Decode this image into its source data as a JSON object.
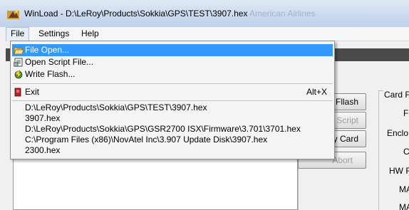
{
  "window": {
    "title": "WinLoad - D:\\LeRoy\\Products\\Sokkia\\GPS\\TEST\\3907.hex",
    "background_title": "American Airlines"
  },
  "menubar": {
    "items": [
      "File",
      "Settings",
      "Help"
    ]
  },
  "file_menu": {
    "items": [
      {
        "label": "File Open...",
        "icon": "folder-open-icon",
        "selected": true
      },
      {
        "label": "Open Script File...",
        "icon": "script-icon"
      },
      {
        "label": "Write Flash...",
        "icon": "flash-icon"
      },
      {
        "label": "Exit",
        "icon": "exit-icon",
        "shortcut": "Alt+X"
      }
    ],
    "recent_files": [
      "D:\\LeRoy\\Products\\Sokkia\\GPS\\TEST\\3907.hex",
      "3907.hex",
      "D:\\LeRoy\\Products\\Sokkia\\GPS\\GSR2700 ISX\\Firmware\\3.701\\3701.hex",
      "C:\\Program Files (x86)\\NovAtel Inc\\3.907 Update Disk\\3907.hex",
      "2300.hex"
    ]
  },
  "buttons": {
    "flash": "Fllash",
    "script": "Script",
    "card": "y Card",
    "abort": "Abort"
  },
  "card_group": {
    "caption": "Card F",
    "labels": [
      "F",
      "Enclo",
      "C",
      "HW F",
      "MA",
      "MA"
    ]
  },
  "colors": {
    "selection": "#3399ff",
    "title_bar": "#c9d9ee"
  }
}
